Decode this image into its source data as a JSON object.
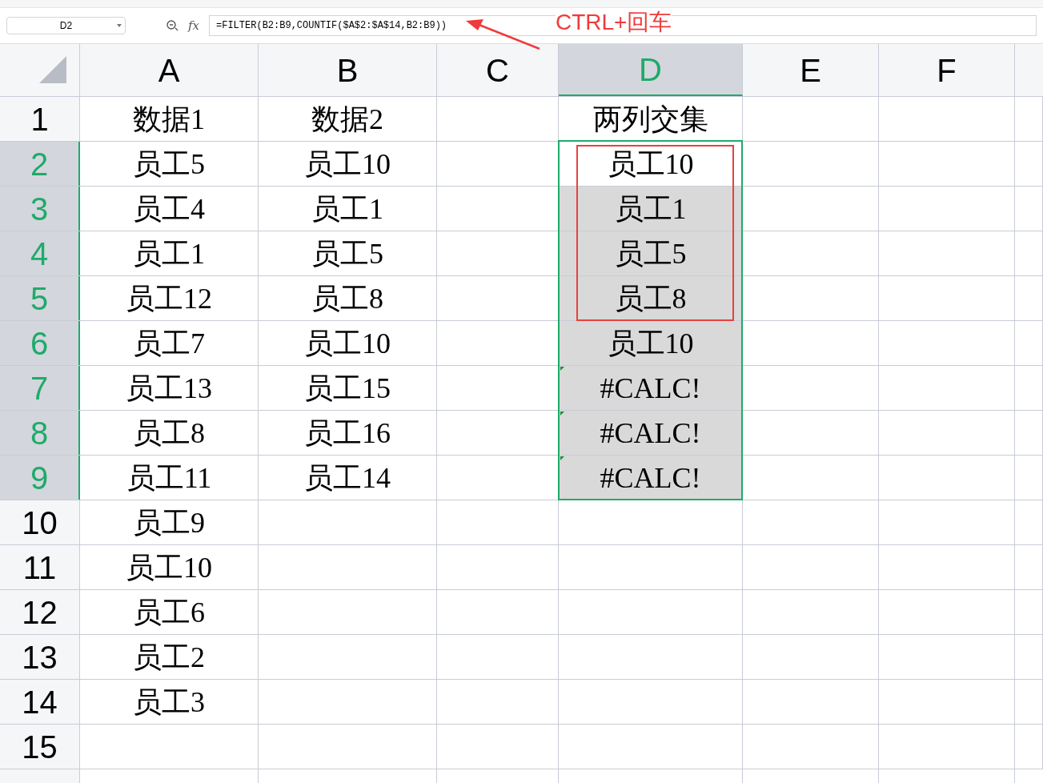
{
  "name_box": "D2",
  "formula": "=FILTER(B2:B9,COUNTIF($A$2:$A$14,B2:B9))",
  "function_label": "fx",
  "annotation": "CTRL+回车",
  "columns": [
    {
      "label": "A",
      "selected": false
    },
    {
      "label": "B",
      "selected": false
    },
    {
      "label": "C",
      "selected": false
    },
    {
      "label": "D",
      "selected": true
    },
    {
      "label": "E",
      "selected": false
    },
    {
      "label": "F",
      "selected": false
    }
  ],
  "rows": [
    {
      "label": "1",
      "selected": false,
      "boxed": false,
      "error_flag": false,
      "cells": [
        "数据1",
        "数据2",
        "",
        "两列交集"
      ]
    },
    {
      "label": "2",
      "selected": true,
      "boxed": true,
      "error_flag": false,
      "cells": [
        "员工5",
        "员工10",
        "",
        "员工10"
      ]
    },
    {
      "label": "3",
      "selected": true,
      "boxed": true,
      "error_flag": false,
      "cells": [
        "员工4",
        "员工1",
        "",
        "员工1"
      ]
    },
    {
      "label": "4",
      "selected": true,
      "boxed": true,
      "error_flag": false,
      "cells": [
        "员工1",
        "员工5",
        "",
        "员工5"
      ]
    },
    {
      "label": "5",
      "selected": true,
      "boxed": true,
      "error_flag": false,
      "cells": [
        "员工12",
        "员工8",
        "",
        "员工8"
      ]
    },
    {
      "label": "6",
      "selected": true,
      "boxed": false,
      "error_flag": false,
      "cells": [
        "员工7",
        "员工10",
        "",
        "员工10"
      ]
    },
    {
      "label": "7",
      "selected": true,
      "boxed": false,
      "error_flag": true,
      "cells": [
        "员工13",
        "员工15",
        "",
        "#CALC!"
      ]
    },
    {
      "label": "8",
      "selected": true,
      "boxed": false,
      "error_flag": true,
      "cells": [
        "员工8",
        "员工16",
        "",
        "#CALC!"
      ]
    },
    {
      "label": "9",
      "selected": true,
      "boxed": false,
      "error_flag": true,
      "cells": [
        "员工11",
        "员工14",
        "",
        "#CALC!"
      ]
    },
    {
      "label": "10",
      "selected": false,
      "boxed": false,
      "error_flag": false,
      "cells": [
        "员工9",
        "",
        "",
        ""
      ]
    },
    {
      "label": "11",
      "selected": false,
      "boxed": false,
      "error_flag": false,
      "cells": [
        "员工10",
        "",
        "",
        ""
      ]
    },
    {
      "label": "12",
      "selected": false,
      "boxed": false,
      "error_flag": false,
      "cells": [
        "员工6",
        "",
        "",
        ""
      ]
    },
    {
      "label": "13",
      "selected": false,
      "boxed": false,
      "error_flag": false,
      "cells": [
        "员工2",
        "",
        "",
        ""
      ]
    },
    {
      "label": "14",
      "selected": false,
      "boxed": false,
      "error_flag": false,
      "cells": [
        "员工3",
        "",
        "",
        ""
      ]
    },
    {
      "label": "15",
      "selected": false,
      "boxed": false,
      "error_flag": false,
      "cells": [
        "",
        "",
        "",
        ""
      ]
    }
  ]
}
